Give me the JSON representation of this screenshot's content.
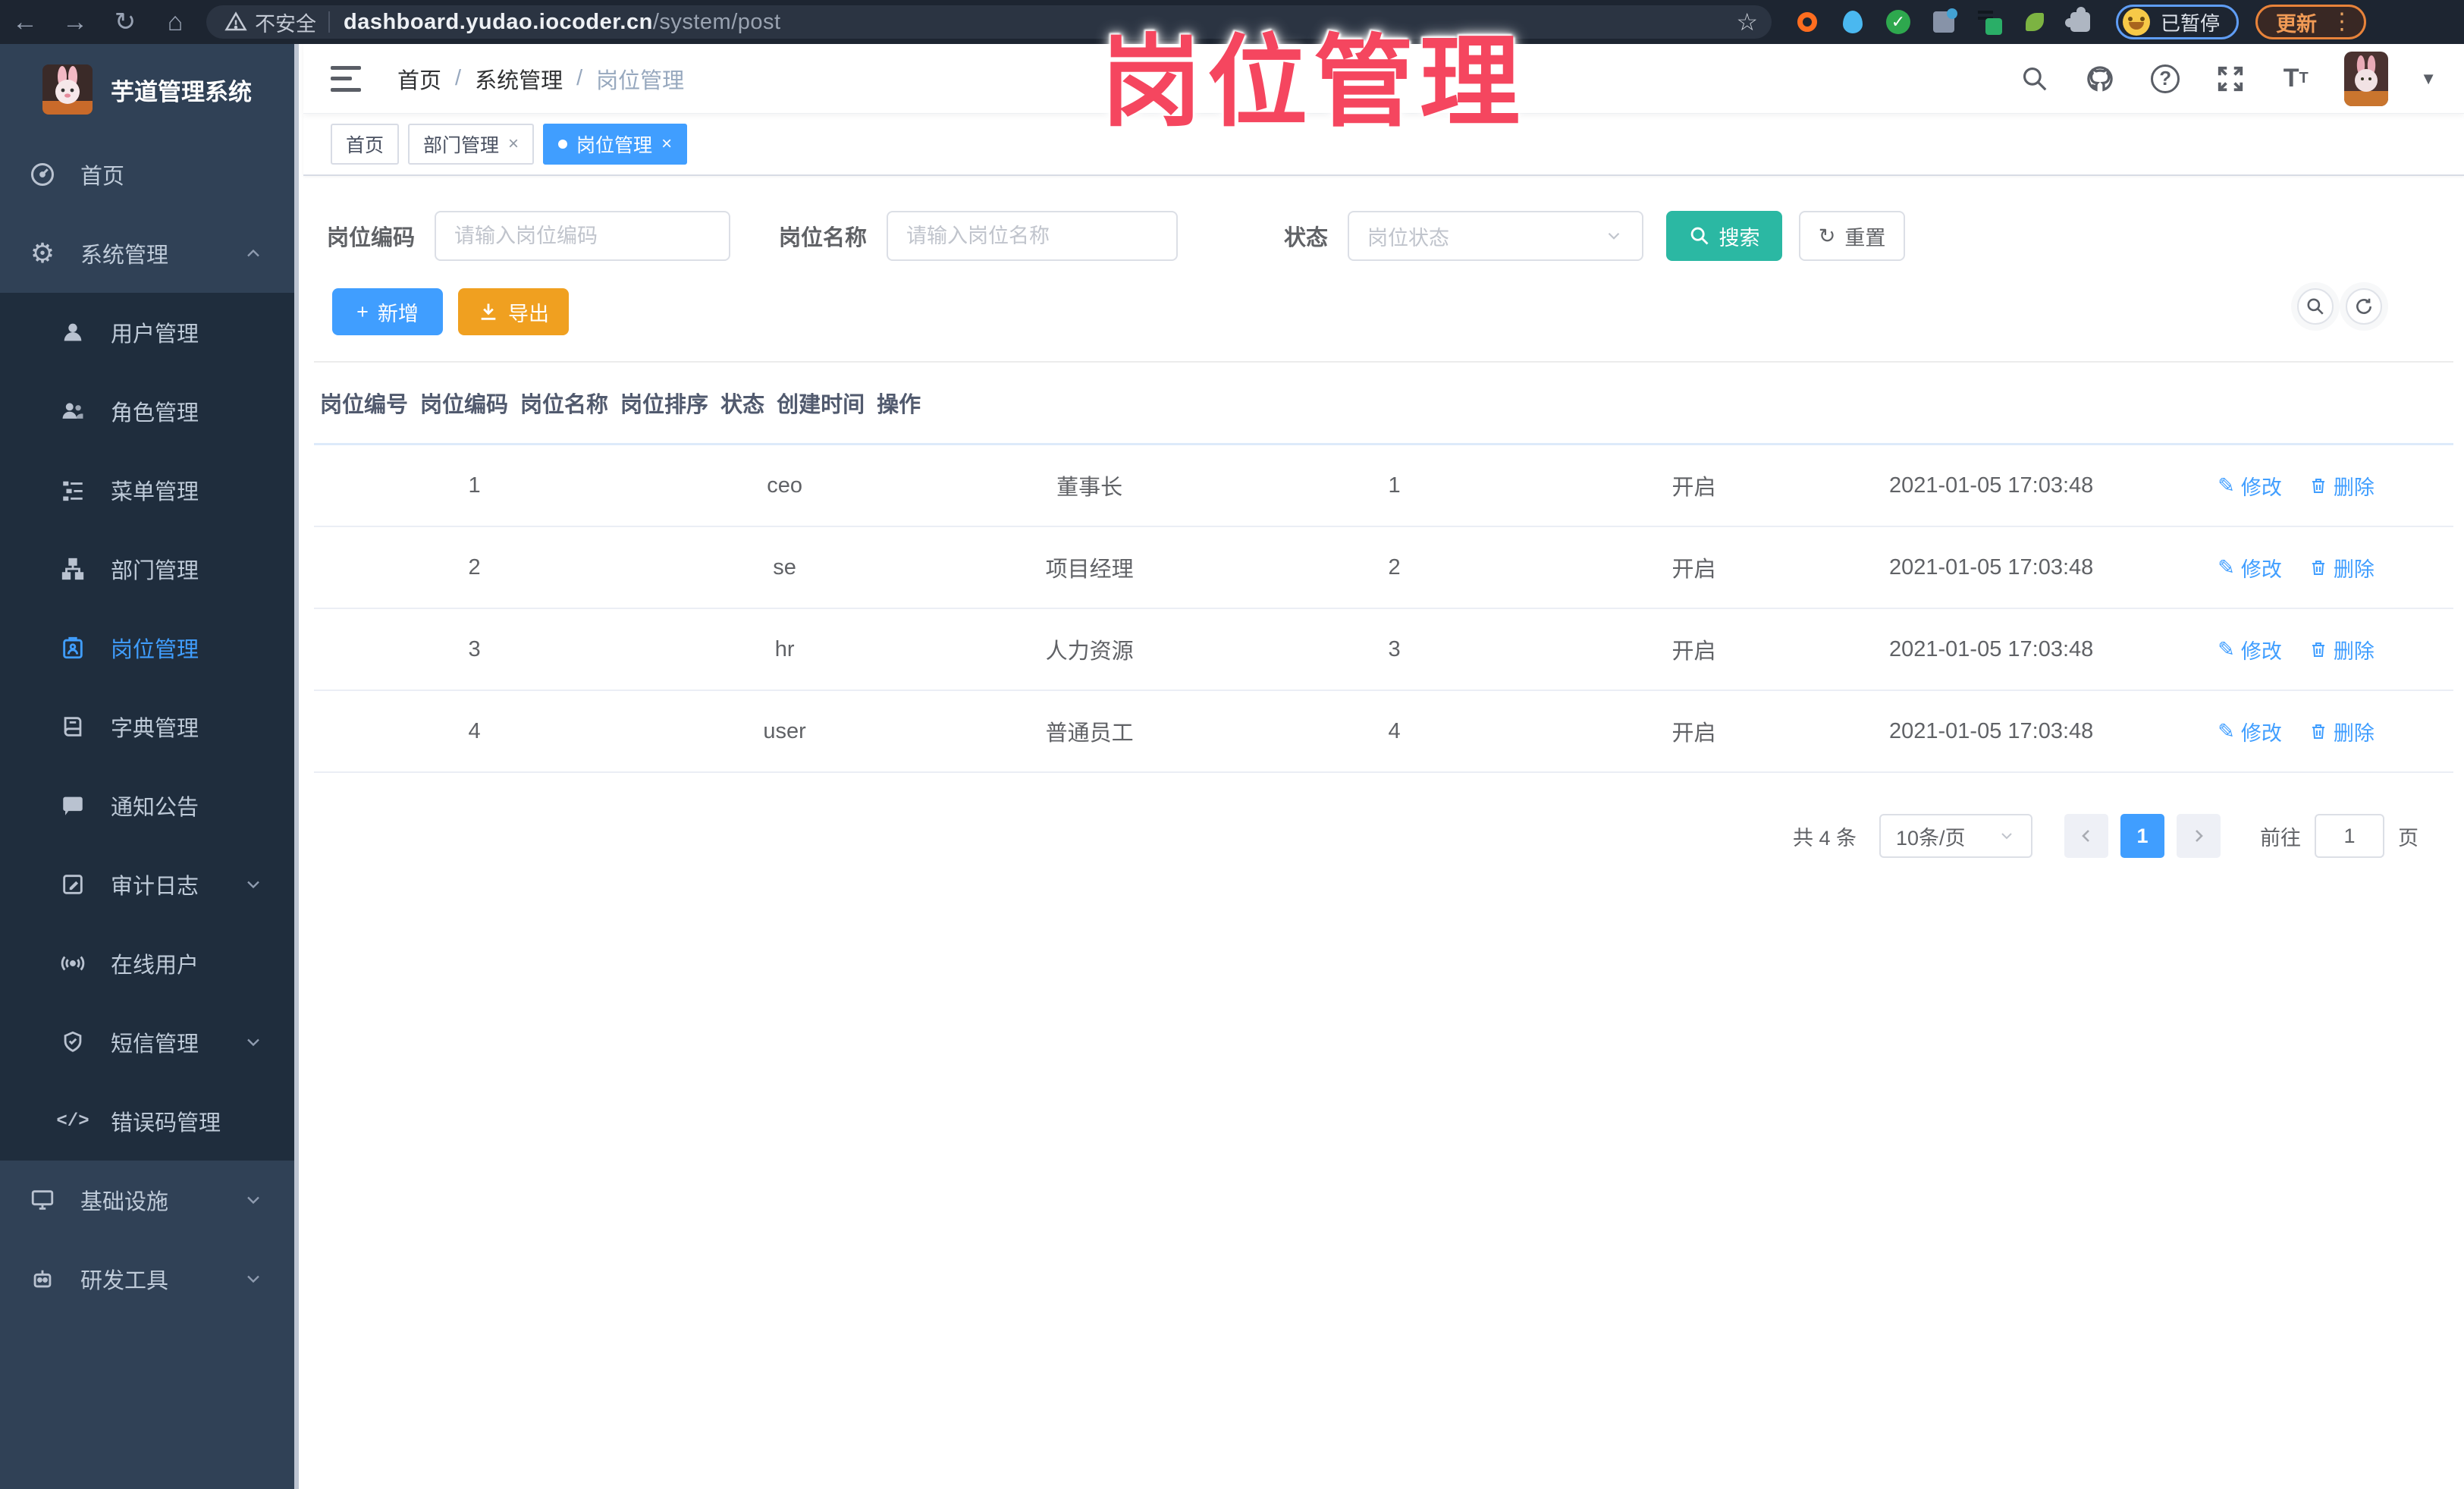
{
  "browser": {
    "back_icon": "←",
    "forward_icon": "→",
    "reload_icon": "↻",
    "home_icon": "⌂",
    "security_label": "不安全",
    "url_host": "dashboard.yudao.iocoder.cn",
    "url_path": "/system/post",
    "star_icon": "☆",
    "paused_label": "已暂停",
    "update_label": "更新",
    "kebab_icon": "⋮"
  },
  "watermark": "岗位管理",
  "sidebar": {
    "title": "芋道管理系统",
    "gear_icon": "⚙",
    "code_icon": "</>",
    "items": [
      {
        "label": "首页"
      },
      {
        "label": "系统管理"
      },
      {
        "label": "用户管理"
      },
      {
        "label": "角色管理"
      },
      {
        "label": "菜单管理"
      },
      {
        "label": "部门管理"
      },
      {
        "label": "岗位管理"
      },
      {
        "label": "字典管理"
      },
      {
        "label": "通知公告"
      },
      {
        "label": "审计日志"
      },
      {
        "label": "在线用户"
      },
      {
        "label": "短信管理"
      },
      {
        "label": "错误码管理"
      },
      {
        "label": "基础设施"
      },
      {
        "label": "研发工具"
      }
    ]
  },
  "header": {
    "breadcrumb": [
      "首页",
      "系统管理",
      "岗位管理"
    ],
    "separator": "/",
    "question_icon": "?"
  },
  "tabs": [
    {
      "label": "首页"
    },
    {
      "label": "部门管理"
    },
    {
      "label": "岗位管理"
    }
  ],
  "close_icon": "×",
  "filters": {
    "code_label": "岗位编码",
    "code_placeholder": "请输入岗位编码",
    "name_label": "岗位名称",
    "name_placeholder": "请输入岗位名称",
    "status_label": "状态",
    "status_placeholder": "岗位状态",
    "search_label": "搜索",
    "reset_label": "重置",
    "reset_icon": "↻"
  },
  "toolbar": {
    "add_label": "新增",
    "add_icon": "+",
    "export_label": "导出"
  },
  "table": {
    "columns": [
      "岗位编号",
      "岗位编码",
      "岗位名称",
      "岗位排序",
      "状态",
      "创建时间",
      "操作"
    ],
    "rows": [
      {
        "id": "1",
        "code": "ceo",
        "name": "董事长",
        "sort": "1",
        "status": "开启",
        "created": "2021-01-05 17:03:48"
      },
      {
        "id": "2",
        "code": "se",
        "name": "项目经理",
        "sort": "2",
        "status": "开启",
        "created": "2021-01-05 17:03:48"
      },
      {
        "id": "3",
        "code": "hr",
        "name": "人力资源",
        "sort": "3",
        "status": "开启",
        "created": "2021-01-05 17:03:48"
      },
      {
        "id": "4",
        "code": "user",
        "name": "普通员工",
        "sort": "4",
        "status": "开启",
        "created": "2021-01-05 17:03:48"
      }
    ],
    "edit_label": "修改",
    "edit_icon": "✎",
    "delete_label": "删除"
  },
  "pagination": {
    "total_text": "共 4 条",
    "page_size": "10条/页",
    "current_page": "1",
    "goto_label": "前往",
    "goto_value": "1",
    "page_unit": "页"
  },
  "colors": {
    "accent_blue": "#409eff",
    "search_teal": "#2bb8a3",
    "export_orange": "#f0a020",
    "sidebar_bg": "#304156",
    "submenu_bg": "#1f2d3d",
    "watermark_pink": "#f5465f"
  }
}
